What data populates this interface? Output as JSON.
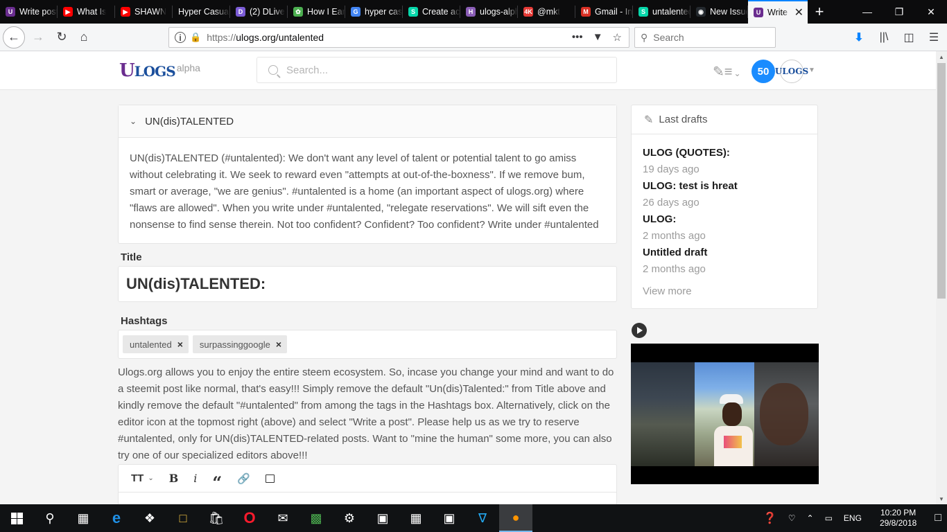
{
  "browser": {
    "tabs": [
      {
        "title": "Write post",
        "favicon": "ulogs",
        "color": "#6a2d8f"
      },
      {
        "title": "What Is",
        "favicon": "youtube",
        "color": "#ff0000"
      },
      {
        "title": "SHAWN",
        "favicon": "youtube",
        "color": "#ff0000"
      },
      {
        "title": "Hyper Casual",
        "favicon": "none",
        "color": "#0c0c0d"
      },
      {
        "title": "(2) DLive",
        "favicon": "dlive",
        "color": "#7b5cd6"
      },
      {
        "title": "How I Earn",
        "favicon": "leaf",
        "color": "#4caf50"
      },
      {
        "title": "hyper casual",
        "favicon": "google",
        "color": "#4285f4"
      },
      {
        "title": "Create account",
        "favicon": "steem",
        "color": "#06d6a9"
      },
      {
        "title": "ulogs-alpha",
        "favicon": "hackmd",
        "color": "#8a5db6"
      },
      {
        "title": "@mkt",
        "favicon": "4k",
        "color": "#e53935"
      },
      {
        "title": "Gmail - Inbox",
        "favicon": "gmail",
        "color": "#d93025"
      },
      {
        "title": "untalented",
        "favicon": "steem",
        "color": "#06d6a9"
      },
      {
        "title": "New Issue",
        "favicon": "github",
        "color": "#24292e"
      },
      {
        "title": "Write post",
        "favicon": "ulogs",
        "color": "#6a2d8f",
        "active": true
      }
    ],
    "url_scheme": "https://",
    "url_host": "ulogs.org/untalented",
    "search_placeholder": "Search"
  },
  "site": {
    "logo_text": "ULOGS",
    "alpha_label": "alpha",
    "search_placeholder": "Search...",
    "vp_badge": "50",
    "avatar_text": "ULOGS"
  },
  "tag_card": {
    "title": "UN(dis)TALENTED",
    "description": "UN(dis)TALENTED (#untalented): We don't want any level of talent or potential talent to go amiss without celebrating it. We seek to reward even \"attempts at out-of-the-boxness\". If we remove bum, smart or average, \"we are genius\". #untalented is a home (an important aspect of ulogs.org) where \"flaws are allowed\". When you write under #untalented, \"relegate reservations\". We will sift even the nonsense to find sense therein. Not too confident? Confident? Too confident? Write under #untalented"
  },
  "form": {
    "title_label": "Title",
    "title_value": "UN(dis)TALENTED:",
    "hashtags_label": "Hashtags",
    "hashtags": [
      "untalented",
      "surpassinggoogle"
    ],
    "note": "Ulogs.org allows you to enjoy the entire steem ecosystem. So, incase you change your mind and want to do a steemit post like normal, that's easy!!! Simply remove the default \"Un(dis)Talented:\" from Title above and kindly remove the default \"#untalented\" from among the tags in the Hashtags box. Alternatively, click on the editor icon at the topmost right (above) and select \"Write a post\". Please help us as we try to reserve #untalented, only for UN(dis)TALENTED-related posts. Want to \"mine the human\" some more, you can also try one of our specialized editors above!!!"
  },
  "drafts": {
    "header": "Last drafts",
    "items": [
      {
        "title": "ULOG (QUOTES):",
        "date": "19 days ago"
      },
      {
        "title": "ULOG: test is hreat",
        "date": "26 days ago"
      },
      {
        "title": "ULOG:",
        "date": "2 months ago"
      },
      {
        "title": "Untitled draft",
        "date": "2 months ago"
      }
    ],
    "view_more": "View more"
  },
  "taskbar": {
    "language": "ENG",
    "time": "10:20 PM",
    "date": "29/8/2018"
  }
}
